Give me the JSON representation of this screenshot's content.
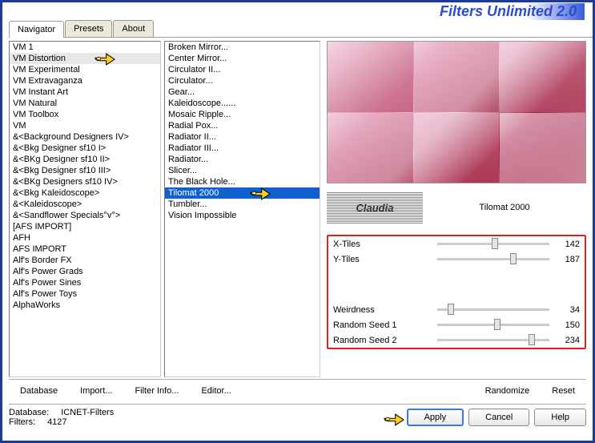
{
  "title": "Filters Unlimited 2.0",
  "tabs": [
    {
      "label": "Navigator",
      "active": true
    },
    {
      "label": "Presets",
      "active": false
    },
    {
      "label": "About",
      "active": false
    }
  ],
  "categories": [
    "VM 1",
    "VM Distortion",
    "VM Experimental",
    "VM Extravaganza",
    "VM Instant Art",
    "VM Natural",
    "VM Toolbox",
    "VM",
    "&<Background Designers IV>",
    "&<Bkg Designer sf10 I>",
    "&<BKg Designer sf10 II>",
    "&<Bkg Designer sf10 III>",
    "&<BKg Designers sf10 IV>",
    "&<Bkg Kaleidoscope>",
    "&<Kaleidoscope>",
    "&<Sandflower Specials°v°>",
    "[AFS IMPORT]",
    "AFH",
    "AFS IMPORT",
    "Alf's Border FX",
    "Alf's Power Grads",
    "Alf's Power Sines",
    "Alf's Power Toys",
    "AlphaWorks"
  ],
  "selected_category_index": 1,
  "filters": [
    "Broken Mirror...",
    "Center Mirror...",
    "Circulator II...",
    "Circulator...",
    "Gear...",
    "Kaleidoscope......",
    "Mosaic Ripple...",
    "Radial Pox...",
    "Radiator II...",
    "Radiator III...",
    "Radiator...",
    "Slicer...",
    "The Black Hole...",
    "Tilomat 2000",
    "Tumbler...",
    "Vision Impossible"
  ],
  "selected_filter_index": 13,
  "brand_text": "Claudia",
  "current_filter": "Tilomat 2000",
  "params": [
    {
      "name": "X-Tiles",
      "value": 142,
      "pct": 55
    },
    {
      "name": "Y-Tiles",
      "value": 187,
      "pct": 73
    }
  ],
  "params2": [
    {
      "name": "Weirdness",
      "value": 34,
      "pct": 13
    },
    {
      "name": "Random Seed 1",
      "value": 150,
      "pct": 58
    },
    {
      "name": "Random Seed 2",
      "value": 234,
      "pct": 91
    }
  ],
  "bottom_buttons": {
    "database": "Database",
    "import": "Import...",
    "filter_info": "Filter Info...",
    "editor": "Editor...",
    "randomize": "Randomize",
    "reset": "Reset"
  },
  "status": {
    "db_label": "Database:",
    "db_value": "ICNET-Filters",
    "filters_label": "Filters:",
    "filters_value": "4127"
  },
  "action_buttons": {
    "apply": "Apply",
    "cancel": "Cancel",
    "help": "Help"
  }
}
